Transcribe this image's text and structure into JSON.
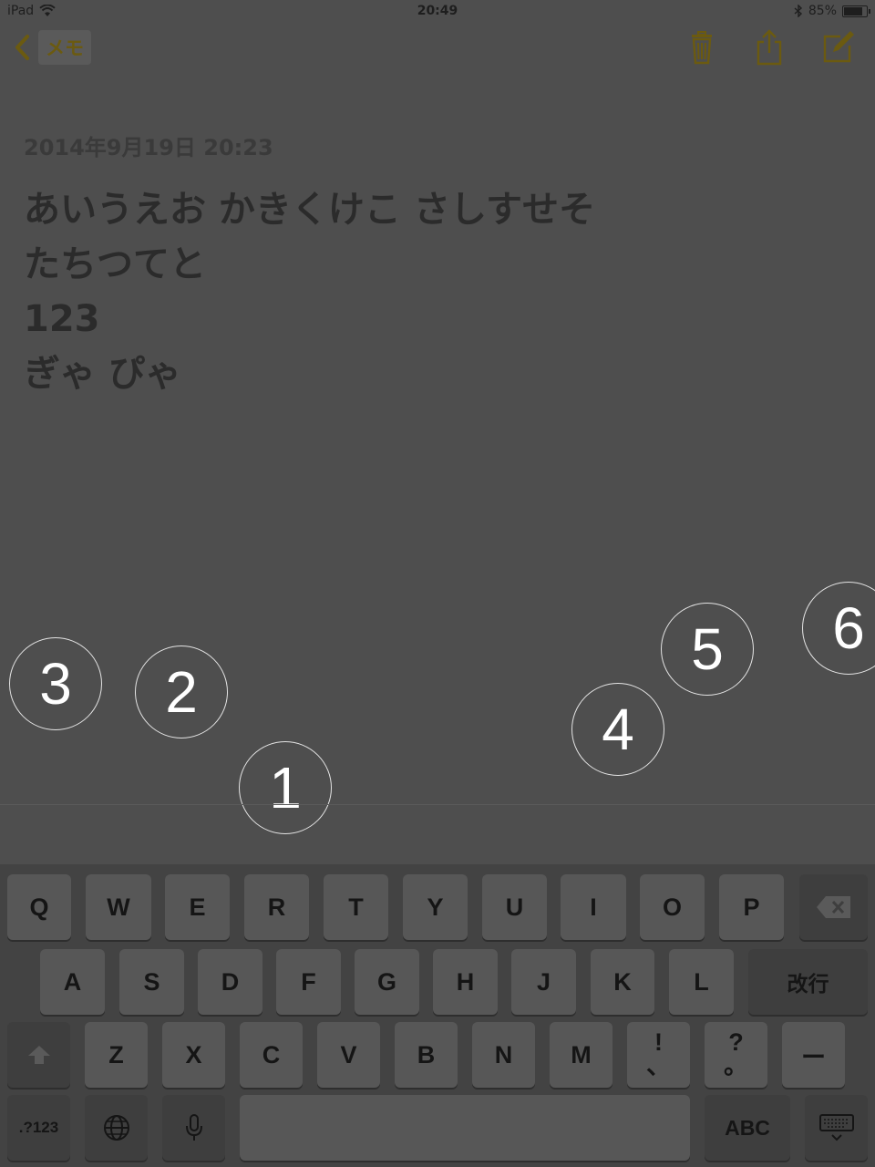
{
  "status_bar": {
    "device": "iPad",
    "time": "20:49",
    "battery_percent": "85%",
    "battery_level": 0.85
  },
  "nav": {
    "back_label": "メモ"
  },
  "note": {
    "date": "2014年9月19日 20:23",
    "lines": [
      "あいうえお  かきくけこ さしすせそ",
      "たちつてと",
      "123",
      "ぎゃ ぴゃ"
    ]
  },
  "annotations": [
    "1",
    "2",
    "3",
    "4",
    "5",
    "6"
  ],
  "keyboard": {
    "row1": [
      "Q",
      "W",
      "E",
      "R",
      "T",
      "Y",
      "U",
      "I",
      "O",
      "P"
    ],
    "row2": [
      "A",
      "S",
      "D",
      "F",
      "G",
      "H",
      "J",
      "K",
      "L"
    ],
    "return_label": "改行",
    "row3": [
      "Z",
      "X",
      "C",
      "V",
      "B",
      "N",
      "M"
    ],
    "punct1_top": "!",
    "punct1_bottom": "、",
    "punct2_top": "?",
    "punct2_bottom": "。",
    "dash_label": "ー",
    "numbers_label": ".?123",
    "abc_label": "ABC"
  },
  "colors": {
    "accent": "#6b5a10",
    "background": "#4e4e4e",
    "keyboard": "#434343"
  }
}
